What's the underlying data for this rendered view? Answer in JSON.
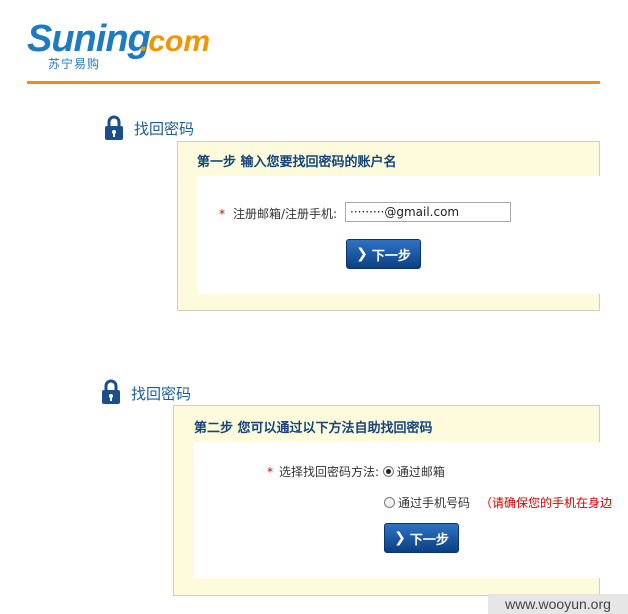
{
  "logo": {
    "brand": "Suning",
    "dotcom": ".com",
    "chinese": "苏宁易购"
  },
  "section1": {
    "title": "找回密码",
    "step_heading": "第一步 输入您要找回密码的账户名",
    "required_mark": "*",
    "field_label": "注册邮箱/注册手机:",
    "field_value": "·········@gmail.com",
    "next_button": "下一步"
  },
  "section2": {
    "title": "找回密码",
    "step_heading": "第二步 您可以通过以下方法自助找回密码",
    "required_mark": "*",
    "method_label": "选择找回密码方法:",
    "option_email": "通过邮箱",
    "option_phone": "通过手机号码",
    "phone_warning": "（请确保您的手机在身边",
    "next_button": "下一步"
  },
  "watermark": "www.wooyun.org",
  "colors": {
    "brand_blue": "#1f7bbf",
    "brand_orange": "#f29400",
    "heading_blue": "#14467c",
    "required_red": "#d60000"
  },
  "icons": {
    "lock": "padlock-icon",
    "chevron": "chevron-right-icon"
  }
}
